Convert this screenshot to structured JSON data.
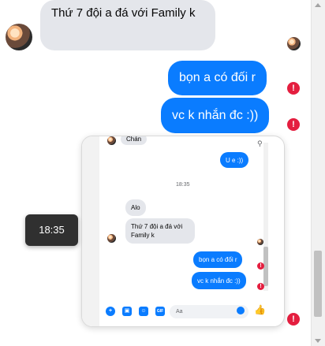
{
  "messages": {
    "incoming_1": "Thứ 7 đội a đá với Family k",
    "outgoing_1": "bọn a có đối r",
    "outgoing_2": "vc k nhắn đc :))"
  },
  "error_symbol": "!",
  "tooltip_time": "18:35",
  "thumbnail": {
    "truncated_text": "Chán",
    "sent_u": "U e :))",
    "timestamp": "18:35",
    "alo": "Alo",
    "incoming_1": "Thứ 7 đội a đá với Family k",
    "outgoing_1": "bọn a có đối r",
    "outgoing_2": "vc k nhắn đc :))",
    "input_placeholder": "Aa",
    "gif_label": "GIF"
  },
  "colors": {
    "outgoing": "#0a7cff",
    "incoming": "#e4e6eb",
    "error": "#e41e3f"
  }
}
